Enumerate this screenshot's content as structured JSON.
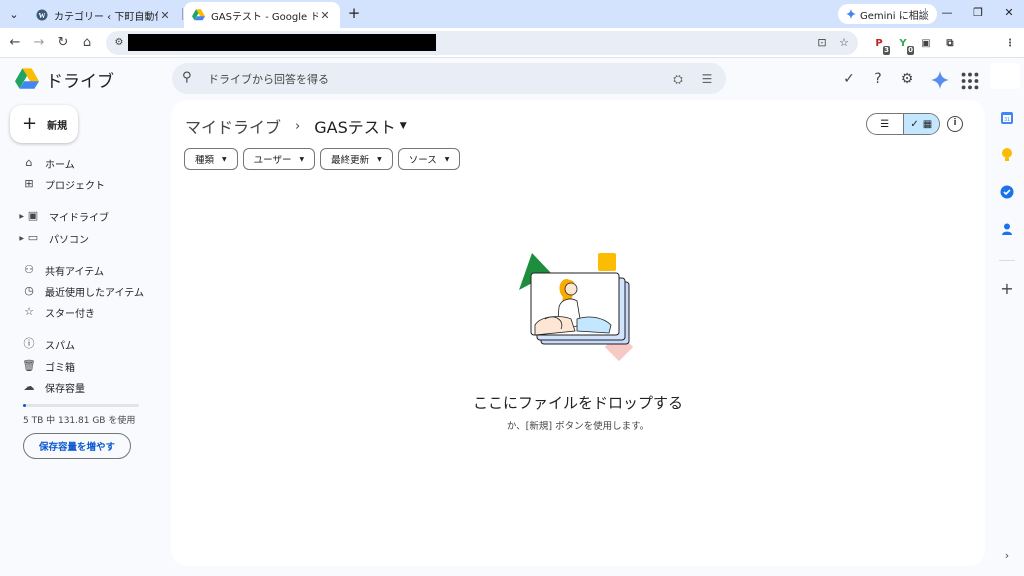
{
  "browser": {
    "tabs": [
      {
        "title": "カテゴリー ‹ 下町自動化 — WordPress",
        "favicon": "wordpress-icon",
        "active": false
      },
      {
        "title": "GASテスト - Google ドライブ",
        "favicon": "google-drive-icon",
        "active": true
      }
    ],
    "gemini_chip": "Gemini に相談",
    "url": "",
    "extension_badges": [
      "3",
      "0"
    ]
  },
  "app": {
    "name": "ドライブ",
    "search_placeholder": "ドライブから回答を得る"
  },
  "sidebar": {
    "new_label": "新規",
    "items": [
      {
        "label": "ホーム",
        "icon": "home-icon"
      },
      {
        "label": "プロジェクト",
        "icon": "projects-icon"
      },
      {
        "label": "マイドライブ",
        "icon": "my-drive-icon"
      },
      {
        "label": "パソコン",
        "icon": "computers-icon"
      },
      {
        "label": "共有アイテム",
        "icon": "shared-icon"
      },
      {
        "label": "最近使用したアイテム",
        "icon": "recent-icon"
      },
      {
        "label": "スター付き",
        "icon": "star-icon"
      },
      {
        "label": "スパム",
        "icon": "spam-icon"
      },
      {
        "label": "ゴミ箱",
        "icon": "trash-icon"
      },
      {
        "label": "保存容量",
        "icon": "cloud-icon"
      }
    ],
    "storage_text": "5 TB 中 131.81 GB を使用",
    "storage_fraction": 0.026,
    "storage_button": "保存容量を増やす"
  },
  "main": {
    "breadcrumb_root": "マイドライブ",
    "breadcrumb_current": "GASテスト",
    "filters": [
      "種類",
      "ユーザー",
      "最終更新",
      "ソース"
    ],
    "empty_title": "ここにファイルをドロップする",
    "empty_subtitle": "か、[新規] ボタンを使用します。"
  },
  "colors": {
    "accent": "#0b57d0",
    "selected_toggle": "#c2e7ff",
    "tabbar": "#d3e3fd",
    "page_bg": "#f8fafd"
  }
}
